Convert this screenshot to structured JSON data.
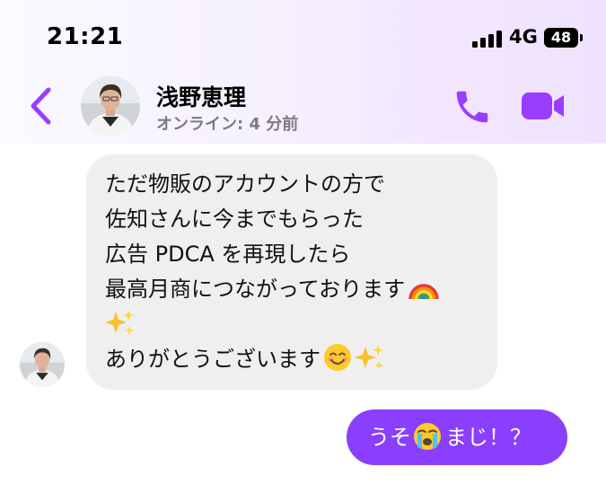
{
  "status_bar": {
    "time": "21:21",
    "network": "4G",
    "battery": "48"
  },
  "header": {
    "contact_name": "浅野恵理",
    "contact_status": "オンライン: 4 分前",
    "accent_color": "#9b3dff"
  },
  "messages": {
    "incoming": {
      "lines": [
        "ただ物販のアカウントの方で",
        "佐知さんに今までもらった",
        "広告 PDCA を再現したら",
        "最高月商につながっております",
        "",
        "ありがとうございます"
      ],
      "emojis": [
        "rainbow-emoji",
        "sparkles-emoji",
        "smiling-face-emoji",
        "sparkles-emoji"
      ],
      "bubble_color": "#efefef"
    },
    "outgoing": {
      "text_before": "うそ",
      "text_after": "まじ！？",
      "emoji": "loudly-crying-face-emoji",
      "bubble_color": "#8a3ffc"
    }
  }
}
